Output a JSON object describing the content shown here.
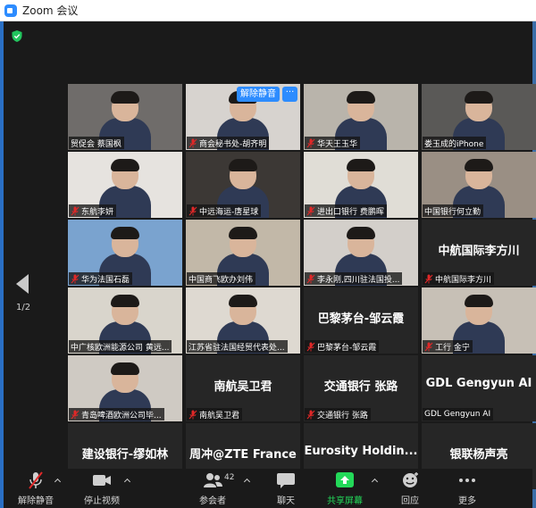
{
  "window": {
    "title": "Zoom 会议"
  },
  "pager": {
    "text": "1/2"
  },
  "hover": {
    "unmute": "解除静音",
    "more": "···"
  },
  "tiles": [
    {
      "name": "贸促会 蔡国枫",
      "muted": false,
      "video": true,
      "bg": "#6f6c6a"
    },
    {
      "name": "商会秘书处-胡齐明",
      "muted": true,
      "video": true,
      "bg": "#d7d3cf"
    },
    {
      "name": "华天王玉华",
      "muted": true,
      "video": true,
      "bg": "#b9b4ab"
    },
    {
      "name": "娄玉成的iPhone",
      "muted": false,
      "video": true,
      "bg": "#5a5957"
    },
    {
      "name": "东航李妍",
      "muted": true,
      "video": true,
      "bg": "#e6e3df"
    },
    {
      "name": "中远海运-唐星球",
      "muted": true,
      "video": true,
      "bg": "#3c3835"
    },
    {
      "name": "进出口银行 费鹏晖",
      "muted": true,
      "video": true,
      "bg": "#e0ddd6"
    },
    {
      "name": "中国银行何立勤",
      "muted": false,
      "video": true,
      "bg": "#9a8f84",
      "active": true
    },
    {
      "name": "华为法国石磊",
      "muted": true,
      "video": true,
      "bg": "#7aa3cf"
    },
    {
      "name": "中国商飞欧办刘伟",
      "muted": false,
      "video": true,
      "bg": "#c2b8a8"
    },
    {
      "name": "李永刚,四川驻法国投...",
      "muted": true,
      "video": true,
      "bg": "#d3cfca"
    },
    {
      "name": "中航国际李方川",
      "muted": true,
      "video": false
    },
    {
      "name": "中广核欧洲能源公司 黄远...",
      "muted": false,
      "video": true,
      "bg": "#d9d5cc"
    },
    {
      "name": "江苏省驻法国经贸代表处...",
      "muted": false,
      "video": true,
      "bg": "#ded9d1"
    },
    {
      "name": "巴黎茅台-邹云霞",
      "muted": true,
      "video": false
    },
    {
      "name": "工行 金宁",
      "muted": true,
      "video": true,
      "bg": "#c7c0b6"
    },
    {
      "name": "青岛啤酒欧洲公司毕...",
      "muted": true,
      "video": true,
      "bg": "#cfcac3"
    },
    {
      "name": "南航吴卫君",
      "muted": true,
      "video": false
    },
    {
      "name": "交通银行 张路",
      "muted": true,
      "video": false
    },
    {
      "name": "GDL Gengyun AI",
      "muted": false,
      "video": false
    },
    {
      "name": "建设银行-缪如林",
      "muted": true,
      "video": false
    },
    {
      "name": "周冲@ZTE France",
      "muted": true,
      "video": false
    },
    {
      "name": "Eurosity Holdings BCL",
      "muted": false,
      "video": false,
      "big": "Eurosity Holdin..."
    },
    {
      "name": "银联杨声亮",
      "muted": true,
      "video": false
    }
  ],
  "toolbar": {
    "unmute": "解除静音",
    "stop_video": "停止视频",
    "participants": "参会者",
    "participants_count": "42",
    "chat": "聊天",
    "share": "共享屏幕",
    "reactions": "回应",
    "more": "更多"
  },
  "colors": {
    "accent": "#2d8cff",
    "share_green": "#23d959",
    "mute_red": "#e02828",
    "active_outline": "#c7e64a"
  }
}
